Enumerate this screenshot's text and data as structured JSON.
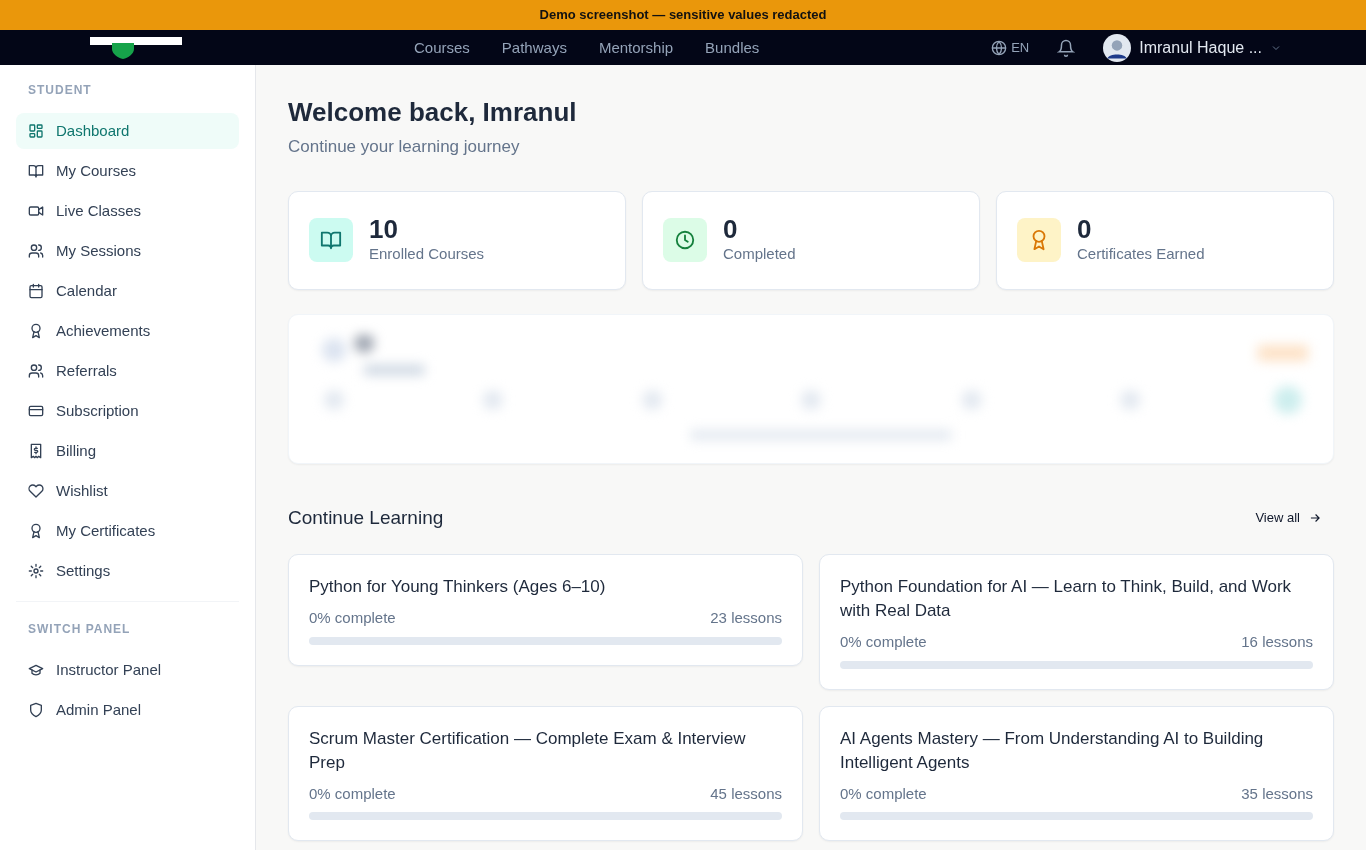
{
  "banner": {
    "text": "Demo screenshot — sensitive values redacted"
  },
  "navbar": {
    "links": [
      "Courses",
      "Pathways",
      "Mentorship",
      "Bundles"
    ],
    "language": "EN",
    "user": "Imranul Haque ..."
  },
  "sidebar": {
    "sections": [
      {
        "heading": "STUDENT",
        "items": [
          {
            "label": "Dashboard",
            "selected": true
          },
          {
            "label": "My Courses",
            "selected": false
          },
          {
            "label": "Live Classes",
            "selected": false
          },
          {
            "label": "My Sessions",
            "selected": false
          },
          {
            "label": "Calendar",
            "selected": false
          },
          {
            "label": "Achievements",
            "selected": false
          },
          {
            "label": "Referrals",
            "selected": false
          },
          {
            "label": "Subscription",
            "selected": false
          },
          {
            "label": "Billing",
            "selected": false
          },
          {
            "label": "Wishlist",
            "selected": false
          },
          {
            "label": "My Certificates",
            "selected": false
          },
          {
            "label": "Settings",
            "selected": false
          }
        ]
      },
      {
        "heading": "SWITCH PANEL",
        "items": [
          {
            "label": "Instructor Panel",
            "selected": false
          },
          {
            "label": "Admin Panel",
            "selected": false
          }
        ]
      }
    ]
  },
  "header": {
    "title": "Welcome back, Imranul",
    "subtitle": "Continue your learning journey"
  },
  "stats": [
    {
      "value": "10",
      "label": "Enrolled Courses"
    },
    {
      "value": "0",
      "label": "Completed"
    },
    {
      "value": "0",
      "label": "Certificates Earned"
    }
  ],
  "continue_learning": {
    "title": "Continue Learning",
    "view_all": "View all",
    "courses": [
      {
        "title": "Python for Young Thinkers (Ages 6–10)",
        "progress": "0% complete",
        "lessons": "23 lessons",
        "level": 0
      },
      {
        "title": "Python Foundation for AI — Learn to Think, Build, and Work with Real Data",
        "progress": "0% complete",
        "lessons": "16 lessons",
        "level": 0
      },
      {
        "title": "Scrum Master Certification — Complete Exam & Interview Prep",
        "progress": "0% complete",
        "lessons": "45 lessons",
        "level": 0
      },
      {
        "title": "AI Agents Mastery — From Understanding AI to Building Intelligent Agents",
        "progress": "0% complete",
        "lessons": "35 lessons",
        "level": 0
      }
    ]
  }
}
